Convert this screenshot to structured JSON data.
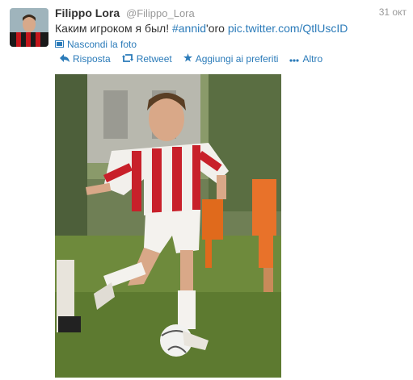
{
  "tweet": {
    "fullname": "Filippo Lora",
    "username": "@Filippo_Lora",
    "timestamp": "31 окт",
    "text_main": "Каким игроком я был! ",
    "hashtag": "#annid",
    "text_suffix": "'oro ",
    "pic_link": "pic.twitter.com/QtlUscID",
    "hide_photo_label": "Nascondi la foto"
  },
  "actions": {
    "reply": "Risposta",
    "retweet": "Retweet",
    "favorite": "Aggiungi ai preferiti",
    "more": "Altro"
  },
  "icons": {
    "reply": "reply-arrow-icon",
    "retweet": "retweet-icon",
    "favorite": "star-icon",
    "more": "more-dots-icon",
    "photo": "photo-icon"
  },
  "colors": {
    "link": "#2b7bb9",
    "muted": "#999999",
    "text": "#333333"
  }
}
